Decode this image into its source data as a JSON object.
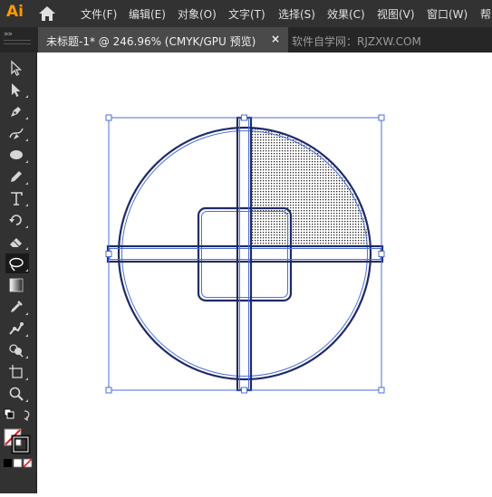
{
  "app": {
    "logo": "Ai"
  },
  "menu": [
    {
      "key": "file",
      "label": "文件(F)"
    },
    {
      "key": "edit",
      "label": "编辑(E)"
    },
    {
      "key": "object",
      "label": "对象(O)"
    },
    {
      "key": "type",
      "label": "文字(T)"
    },
    {
      "key": "select",
      "label": "选择(S)"
    },
    {
      "key": "effect",
      "label": "效果(C)"
    },
    {
      "key": "view",
      "label": "视图(V)"
    },
    {
      "key": "window",
      "label": "窗口(W)"
    },
    {
      "key": "help",
      "label": "帮"
    }
  ],
  "tabs": {
    "collapse": "»»",
    "active": {
      "title": "未标题-1* @ 246.96% (CMYK/GPU 预览)",
      "close": "×"
    },
    "inactive": {
      "title": "软件自学网：RJZXW.COM"
    }
  },
  "tools": [
    {
      "name": "selection-tool",
      "icon": "arrow-icon"
    },
    {
      "name": "direct-selection-tool",
      "icon": "white-arrow-icon"
    },
    {
      "name": "pen-tool",
      "icon": "pen-icon"
    },
    {
      "name": "curvature-tool",
      "icon": "curvature-icon"
    },
    {
      "name": "ellipse-tool",
      "icon": "ellipse-icon"
    },
    {
      "name": "pencil-tool",
      "icon": "pencil-icon"
    },
    {
      "name": "type-tool",
      "icon": "type-icon"
    },
    {
      "name": "rotate-tool",
      "icon": "rotate-icon"
    },
    {
      "name": "eraser-tool",
      "icon": "eraser-icon"
    },
    {
      "name": "lasso-tool",
      "icon": "lasso-icon"
    },
    {
      "name": "gradient-tool",
      "icon": "gradient-icon"
    },
    {
      "name": "eyedropper-tool",
      "icon": "eyedropper-icon"
    },
    {
      "name": "puppet-warp-tool",
      "icon": "puppet-icon"
    },
    {
      "name": "shape-builder-tool",
      "icon": "shape-builder-icon"
    },
    {
      "name": "artboard-tool",
      "icon": "artboard-icon"
    },
    {
      "name": "zoom-tool",
      "icon": "zoom-icon"
    }
  ],
  "colors": {
    "chrome": "#323232",
    "tabbar": "#262626",
    "active_tab": "#4a4a4a",
    "logo": "#ff9a00",
    "artwork_stroke": "#2b3a8c",
    "bbox": "#4a6fd8"
  }
}
